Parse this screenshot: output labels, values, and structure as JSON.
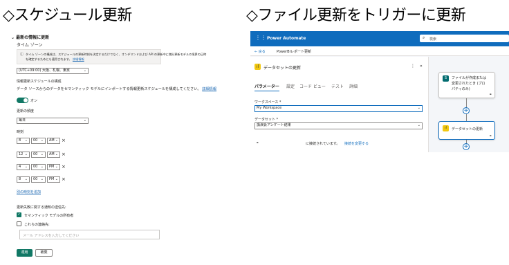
{
  "left": {
    "heading": "◇スケジュール更新",
    "section_title": "最新の情報に更新",
    "timezone_label": "タイム ゾーン",
    "timezone_info": "タイム ゾーンの構成は、スケジュールの更新時刻を決定するだけでなく、オンデマンドおよび API の更新中に増分更新モデルの境界の日時",
    "timezone_info2": "を確定するためにも適用されます。",
    "timezone_info_link": "詳細情報",
    "timezone_value": "(UTC+09:00) 大阪、札幌、東京",
    "config_label": "情報更新スケジュールの構成",
    "config_desc": "データ ソースからのデータをセマンティック モデルにインポートする情報更新スケジュールを構成してください。",
    "config_link": "詳細情報",
    "toggle_label": "オン",
    "frequency_label": "更新の頻度",
    "frequency_value": "毎日",
    "time_label": "時刻",
    "times": [
      {
        "hour": "8",
        "minute": "00",
        "ampm": "AM"
      },
      {
        "hour": "12",
        "minute": "00",
        "ampm": "AM"
      },
      {
        "hour": "4",
        "minute": "00",
        "ampm": "PM"
      },
      {
        "hour": "8",
        "minute": "00",
        "ampm": "PM"
      }
    ],
    "remove_glyph": "×",
    "add_time_link": "別の時刻を追加",
    "notify_label": "更新失敗に関する通知の送信先:",
    "notify_owner": "セマンティック モデルの所有者",
    "notify_others": "これらの連絡先:",
    "email_placeholder": "メール アドレスを入力してください",
    "apply_button": "適用",
    "discard_button": "破棄"
  },
  "right": {
    "heading": "◇ファイル更新をトリガーに更新",
    "app_name": "Power Automate",
    "search_placeholder": "検索",
    "back_label": "戻る",
    "flow_name": "PowerBIレポート更新",
    "panel_title": "データセットの更新",
    "tabs": [
      "パラメーター",
      "設定",
      "コード ビュー",
      "テスト",
      "詳細"
    ],
    "workspace_label": "ワークスペース *",
    "workspace_value": "My Workspace",
    "dataset_label": "データセット *",
    "dataset_value": "講演会アンケート結果",
    "connection_text": "に接続されています。",
    "change_connection": "接続を変更する",
    "trigger_card_line1": "ファイルが作成または",
    "trigger_card_line2": "変更されたとき (プロ",
    "trigger_card_line3": "パティのみ)",
    "action_card": "データセットの更新",
    "plus_glyph": "+"
  },
  "colors": {
    "accent_green": "#117865",
    "pa_blue": "#0f6cbd",
    "powerbi_yellow": "#f2c811",
    "sharepoint_teal": "#036c70"
  }
}
